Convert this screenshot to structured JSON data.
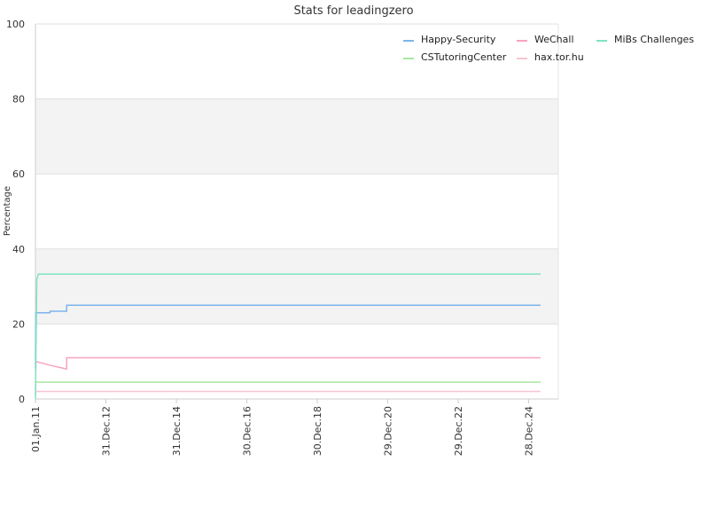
{
  "chart_data": {
    "type": "line",
    "title": "Stats for leadingzero",
    "xlabel": "",
    "ylabel": "Percentage",
    "ylim": [
      0,
      100
    ],
    "yticks": [
      0,
      20,
      40,
      60,
      80,
      100
    ],
    "xlim": [
      "2011-01-01",
      "2025-11-01"
    ],
    "xticks": [
      {
        "label": "01.Jan.11",
        "date": "2011-01-01"
      },
      {
        "label": "31.Dec.12",
        "date": "2012-12-31"
      },
      {
        "label": "31.Dec.14",
        "date": "2014-12-31"
      },
      {
        "label": "30.Dec.16",
        "date": "2016-12-30"
      },
      {
        "label": "30.Dec.18",
        "date": "2018-12-30"
      },
      {
        "label": "29.Dec.20",
        "date": "2020-12-29"
      },
      {
        "label": "29.Dec.22",
        "date": "2022-12-29"
      },
      {
        "label": "28.Dec.24",
        "date": "2024-12-28"
      }
    ],
    "grid": true,
    "alternating_bands": true,
    "band_color": "#f3f3f3",
    "legend_position": "top-right",
    "series": [
      {
        "name": "Happy-Security",
        "color": "#7cb5ec",
        "points": [
          [
            "2011-01-01",
            8
          ],
          [
            "2011-01-05",
            23
          ],
          [
            "2011-06-01",
            23
          ],
          [
            "2011-06-02",
            23.4
          ],
          [
            "2011-11-20",
            23.4
          ],
          [
            "2011-11-21",
            25
          ],
          [
            "2025-05-01",
            25
          ]
        ]
      },
      {
        "name": "WeChall",
        "color": "#f7a3bf",
        "points": [
          [
            "2011-01-01",
            1
          ],
          [
            "2011-01-05",
            10
          ],
          [
            "2011-06-01",
            9
          ],
          [
            "2011-11-20",
            8
          ],
          [
            "2011-11-21",
            11
          ],
          [
            "2025-05-01",
            11
          ]
        ]
      },
      {
        "name": "MiBs Challenges",
        "color": "#7fe3c4",
        "points": [
          [
            "2011-01-01",
            0
          ],
          [
            "2011-01-15",
            32
          ],
          [
            "2011-02-01",
            33.3
          ],
          [
            "2025-05-01",
            33.3
          ]
        ]
      },
      {
        "name": "CSTutoringCenter",
        "color": "#a8e6a0",
        "points": [
          [
            "2011-01-01",
            4.5
          ],
          [
            "2025-05-01",
            4.5
          ]
        ]
      },
      {
        "name": "hax.tor.hu",
        "color": "#f6c6d0",
        "points": [
          [
            "2011-01-01",
            2
          ],
          [
            "2025-05-01",
            2
          ]
        ]
      }
    ]
  }
}
